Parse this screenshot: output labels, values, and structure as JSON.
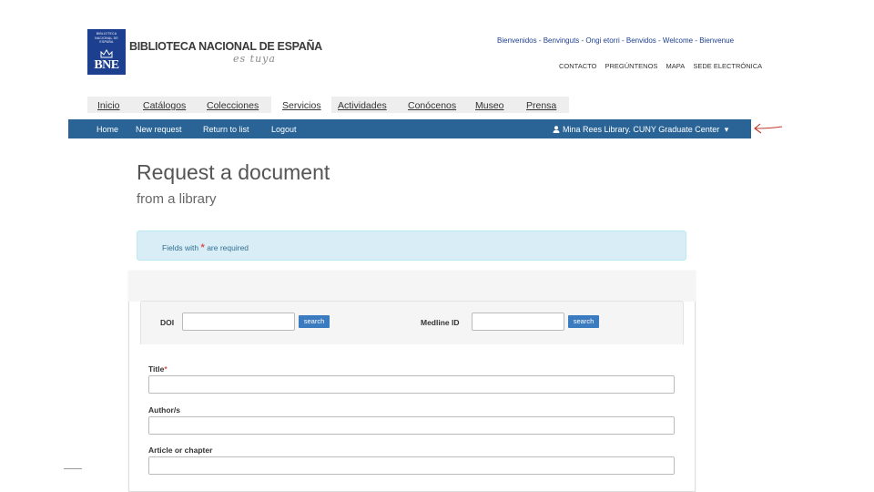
{
  "header": {
    "logo": {
      "crest_text": "BIBLIOTECA NACIONAL DE ESPAÑA",
      "abbr": "BNE"
    },
    "title": "BIBLIOTECA NACIONAL DE ESPAÑA",
    "tagline": "es tuya",
    "languages": [
      "Bienvenidos",
      "Benvinguts",
      "Ongi etorri",
      "Benvidos",
      "Welcome",
      "Bienvenue"
    ],
    "language_separator": " - ",
    "utility_links": [
      "CONTACTO",
      "PREGÚNTENOS",
      "MAPA",
      "SEDE ELECTRÓNICA"
    ],
    "brand_color": "#1d3f8f"
  },
  "site_nav": {
    "items": [
      {
        "label": "Inicio",
        "active": false
      },
      {
        "label": "Catálogos",
        "active": false
      },
      {
        "label": "Colecciones",
        "active": false
      },
      {
        "label": "Servicios",
        "active": true
      },
      {
        "label": "Actividades",
        "active": false
      },
      {
        "label": "Conócenos",
        "active": false
      },
      {
        "label": "Museo",
        "active": false
      },
      {
        "label": "Prensa",
        "active": false
      }
    ]
  },
  "library_bar": {
    "links": [
      "Home",
      "New request",
      "Return to list",
      "Logout"
    ],
    "user_label": "Mina Rees Library. CUNY Graduate Center",
    "user_caret": "▾",
    "bar_color": "#2a6496",
    "annotation_color": "#c0392b"
  },
  "page": {
    "title": "Request a document",
    "subtitle": "from a library"
  },
  "alert": {
    "prefix": "Fields with",
    "star": "*",
    "suffix": "are required"
  },
  "form": {
    "doi": {
      "label": "DOI",
      "value": "",
      "button": "search"
    },
    "medline": {
      "label": "Medline ID",
      "value": "",
      "button": "search"
    },
    "title": {
      "label": "Title",
      "required_mark": "*",
      "value": ""
    },
    "authors": {
      "label": "Author/s",
      "value": ""
    },
    "article": {
      "label": "Article or chapter",
      "value": ""
    }
  }
}
